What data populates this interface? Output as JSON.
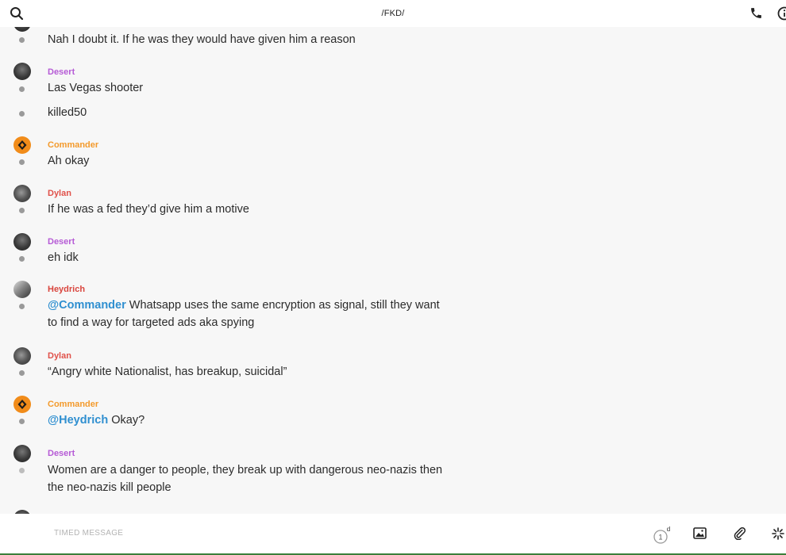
{
  "header": {
    "title": "/FKD/",
    "search_icon": "search-icon",
    "call_icon": "phone-icon",
    "info_icon": "info-icon"
  },
  "colors": {
    "desert": "#b65bd6",
    "commander": "#f39a2c",
    "dylan": "#e0514a",
    "heydrich": "#d9453d",
    "mention": "#2f8fd0"
  },
  "messages": [
    {
      "text": "Nah I doubt it. If he was they would have given him a reason"
    },
    {
      "author": "Desert",
      "text": "Las Vegas shooter"
    },
    {
      "text": "killed50"
    },
    {
      "author": "Commander",
      "text": "Ah okay"
    },
    {
      "author": "Dylan",
      "text": "If he was a fed they’d give him a motive"
    },
    {
      "author": "Desert",
      "text": "eh idk"
    },
    {
      "author": "Heydrich",
      "mention": "@Commander",
      "text": " Whatsapp uses the same encryption as signal, still they want to find a way for targeted ads aka spying"
    },
    {
      "author": "Dylan",
      "text": "“Angry white Nationalist, has breakup, suicidal”"
    },
    {
      "author": "Commander",
      "mention": "@Heydrich",
      "text": " Okay?"
    },
    {
      "author": "Desert",
      "text": "Women are a danger to people, they break up with dangerous neo-nazis then the neo-nazis kill people"
    }
  ],
  "composer": {
    "placeholder": "TIMED MESSAGE",
    "timer_value": "1",
    "timer_unit": "d",
    "image_icon": "image-icon",
    "attach_icon": "paperclip-icon",
    "more_icon": "sparkle-icon"
  }
}
